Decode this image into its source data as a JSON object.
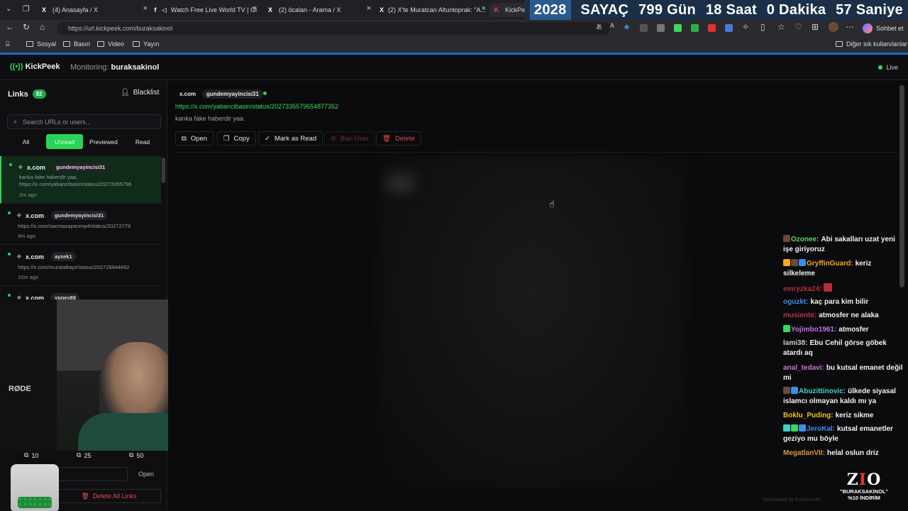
{
  "browser": {
    "tabs": [
      {
        "icon": "X",
        "label": "(4) Anasayfa / X"
      },
      {
        "icon": "f",
        "label": "Watch Free Live World TV | Gl"
      },
      {
        "icon": "X",
        "label": "(2) öcalan - Arama / X"
      },
      {
        "icon": "X",
        "label": "(2) X'te Muratcan Altuntoprak: \"A..."
      },
      {
        "icon": "K",
        "label": "KickPeek"
      }
    ],
    "url": "https://url.kickpeek.com/buraksakinol",
    "bookmarks": [
      "Sosyal",
      "Basın",
      "Video",
      "Yayın"
    ],
    "other_bookmarks": "Diğer sık kullanılanlar",
    "chat_label": "Sohbet et"
  },
  "counter": {
    "year": "2028",
    "title": "SAYAÇ",
    "days": "799 Gün",
    "hours": "18 Saat",
    "minutes": "0 Dakika",
    "seconds": "57 Saniye"
  },
  "app": {
    "name": "KickPeek",
    "monitoring_label": "Monitoring:",
    "monitoring_user": "buraksakinol",
    "status": "Live"
  },
  "sidebar": {
    "title": "Links",
    "count": "82",
    "blacklist": "Blacklist",
    "search_placeholder": "Search URLs or users...",
    "filters": [
      "All",
      "Unread",
      "Previewed",
      "Read"
    ],
    "items": [
      {
        "domain": "x.com",
        "user": "gundemyayincisi31",
        "text": "kanka fake haberdir yaa, https://x.com/yabancibasin/status/20273355796",
        "ago": "2m ago"
      },
      {
        "domain": "x.com",
        "user": "gundemyayincisi31",
        "text": "https://x.com/sacmasapanmp4/status/20272776",
        "ago": "9m ago"
      },
      {
        "domain": "x.com",
        "user": "ayzek1",
        "text": "https://x.com/murataltayz/status/202728944692",
        "ago": "10m ago"
      },
      {
        "domain": "x.com",
        "user": "yoney89",
        "text": "",
        "ago": ""
      }
    ],
    "open_counts": [
      "10",
      "25",
      "50"
    ],
    "open_button": "Open",
    "delete_all": "Delete All Links"
  },
  "detail": {
    "domain": "x.com",
    "user": "gundemyayincisi31",
    "url": "https://x.com/yabancibasin/status/2027335579654877352",
    "message": "kanka fake haberdir yaa.",
    "actions": {
      "open": "Open",
      "copy": "Copy",
      "mark_read": "Mark as Read",
      "ban": "Ban User",
      "delete": "Delete"
    }
  },
  "chat": [
    {
      "user": "Ozonee:",
      "color": "#5ed16a",
      "msg": "Abi sakalları uzat yeni işe giriyoruz"
    },
    {
      "user": "GryffinGuard:",
      "color": "#f5a623",
      "msg": "keriz silkeleme"
    },
    {
      "user": "emryzka24:",
      "color": "#b52b3a",
      "msg": ""
    },
    {
      "user": "oguzkt:",
      "color": "#3b8fe8",
      "msg": "kaç para kim bilir"
    },
    {
      "user": "musiente:",
      "color": "#c0304a",
      "msg": "atmosfer ne alaka"
    },
    {
      "user": "Yojimbo1961:",
      "color": "#c46ee8",
      "msg": "atmosfer"
    },
    {
      "user": "lami38:",
      "color": "#c9c9c9",
      "msg": "Ebu Cehil görse göbek atardı aq"
    },
    {
      "user": "anal_tedavi:",
      "color": "#d06ed8",
      "msg": "bu kutsal emanet değil mi"
    },
    {
      "user": "Abuzittinovic:",
      "color": "#3fd4c8",
      "msg": "ülkede siyasal islamcı olmayan kaldı mı ya"
    },
    {
      "user": "Boklu_Puding:",
      "color": "#f0c020",
      "msg": "keriz sikme"
    },
    {
      "user": "JeroKal:",
      "color": "#3b8fe8",
      "msg": "kutsal emanetler geziyo mu böyle"
    },
    {
      "user": "MegatlanVII:",
      "color": "#d69a3a",
      "msg": "helal oslun driz"
    }
  ],
  "footer": {
    "developed_by": "Developed by Rodomonth",
    "promo_line1": "\"BURAKSAKINOL\"",
    "promo_line2": "%10 İNDİRİM"
  }
}
